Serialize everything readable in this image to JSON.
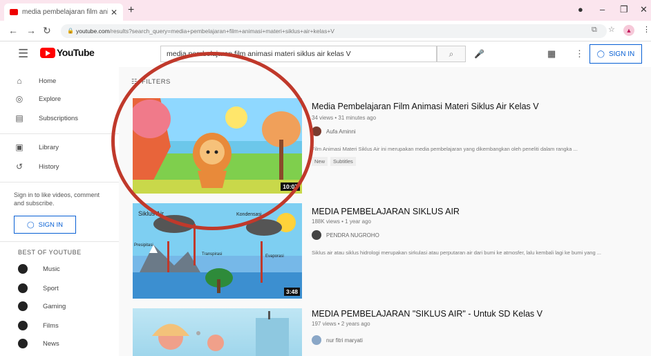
{
  "browser": {
    "tab_title": "media pembelajaran film animasi",
    "tab_close": "✕",
    "new_tab": "+",
    "url_host": "youtube.com",
    "url_path": "/results?search_query=media+pembelajaran+film+animasi+materi+siklus+air+kelas+V"
  },
  "header": {
    "logo_text": "YouTube",
    "search_value": "media pembelajaran film animasi materi siklus air kelas V",
    "signin_label": "SIGN IN"
  },
  "sidebar": {
    "items": [
      {
        "label": "Home",
        "icon": "⌂"
      },
      {
        "label": "Explore",
        "icon": "◎"
      },
      {
        "label": "Subscriptions",
        "icon": "▤"
      },
      {
        "label": "Library",
        "icon": "▣"
      },
      {
        "label": "History",
        "icon": "↺"
      }
    ],
    "signin_message": "Sign in to like videos, comment and subscribe.",
    "signin_label": "SIGN IN",
    "best_heading": "BEST OF YOUTUBE",
    "best_items": [
      {
        "label": "Music"
      },
      {
        "label": "Sport"
      },
      {
        "label": "Gaming"
      },
      {
        "label": "Films"
      },
      {
        "label": "News"
      }
    ]
  },
  "filters_label": "FILTERS",
  "videos": [
    {
      "title": "Media Pembelajaran Film Animasi Materi Siklus Air Kelas V",
      "meta": "34 views • 31 minutes ago",
      "channel": "Aufa Aminni",
      "description": "Film Animasi Materi Siklus Air ini merupakan media pembelajaran yang dikembangkan oleh peneliti dalam rangka ...",
      "badges": [
        "New",
        "Subtitles"
      ],
      "duration": "10:07"
    },
    {
      "title": "MEDIA PEMBELAJARAN SIKLUS AIR",
      "meta": "188K views • 1 year ago",
      "channel": "PENDRA NUGROHO",
      "description": "Siklus air atau siklus hidrologi merupakan sirkulasi atau perputaran air dari bumi ke atmosfer, lalu kembali lagi ke bumi yang ...",
      "duration": "3:48",
      "thumb_labels": {
        "a": "Siklus Air",
        "b": "Kondensasi",
        "c": "Presipitasi",
        "d": "Transpirasi",
        "e": "Evaporasi"
      }
    },
    {
      "title": "MEDIA PEMBELAJARAN \"SIKLUS AIR\" - Untuk SD Kelas V",
      "meta": "197 views • 2 years ago",
      "channel": "nur fitri maryati"
    }
  ]
}
